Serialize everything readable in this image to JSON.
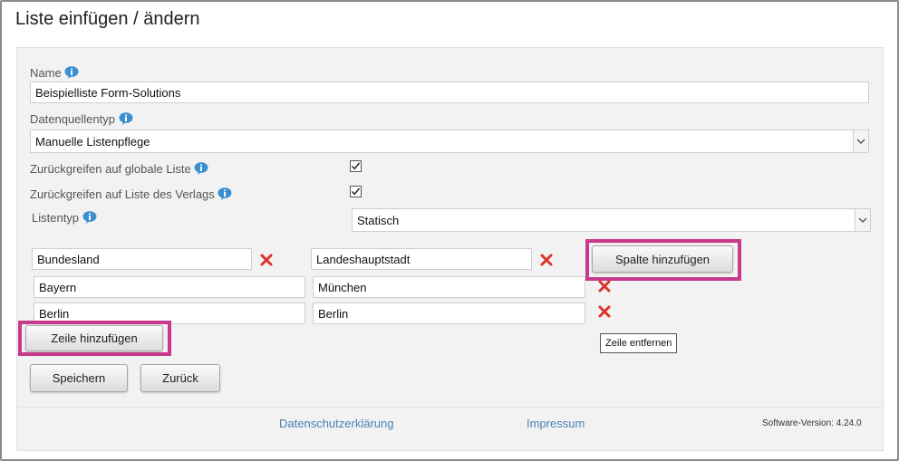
{
  "page": {
    "title": "Liste einfügen / ändern"
  },
  "form": {
    "name_label": "Name",
    "name_value": "Beispielliste Form-Solutions",
    "datasource_label": "Datenquellentyp",
    "datasource_value": "Manuelle Listenpflege",
    "global_list_label": "Zurückgreifen auf globale Liste",
    "global_list_checked": true,
    "publisher_list_label": "Zurückgreifen auf Liste des Verlags",
    "publisher_list_checked": true,
    "listtype_label": "Listentyp",
    "listtype_value": "Statisch"
  },
  "table": {
    "headers": [
      "Bundesland",
      "Landeshauptstadt"
    ],
    "rows": [
      [
        "Bayern",
        "München"
      ],
      [
        "Berlin",
        "Berlin"
      ]
    ],
    "add_column_label": "Spalte hinzufügen",
    "add_row_label": "Zeile hinzufügen",
    "remove_row_tooltip": "Zeile entfernen"
  },
  "actions": {
    "save_label": "Speichern",
    "back_label": "Zurück"
  },
  "footer": {
    "privacy_link": "Datenschutzerklärung",
    "imprint_link": "Impressum",
    "version": "Software-Version: 4.24.0"
  },
  "colors": {
    "highlight": "#c8388c",
    "link": "#4a7fb5",
    "delete_icon": "#d9342b",
    "info_icon": "#3a8fd0"
  },
  "icons": [
    "info-icon",
    "delete-icon",
    "chevron-down-icon",
    "checkmark-icon"
  ]
}
